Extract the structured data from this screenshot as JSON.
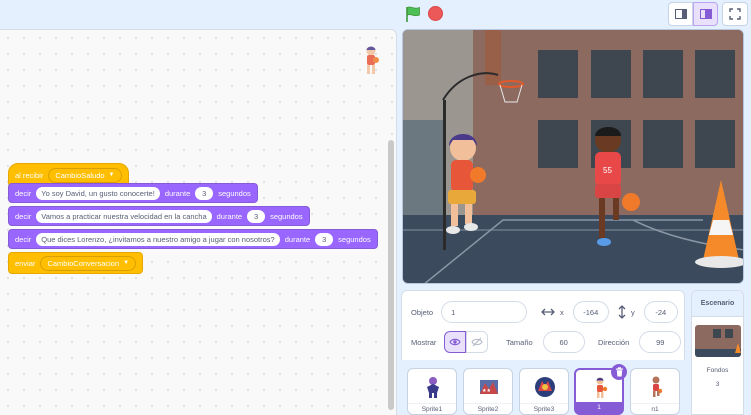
{
  "toolbar": {
    "icons": [
      "green-flag-icon",
      "stop-icon",
      "small-stage-icon",
      "normal-stage-icon",
      "fullscreen-icon"
    ]
  },
  "script": {
    "hat": {
      "label": "al recibir",
      "message": "CambioSaludo"
    },
    "say_blocks": [
      {
        "label": "decir",
        "text": "Yo soy David, un gusto conocerte!",
        "durante": "durante",
        "seconds": "3",
        "unit": "segundos"
      },
      {
        "label": "decir",
        "text": "Vamos a practicar nuestra velocidad en la cancha",
        "durante": "durante",
        "seconds": "3",
        "unit": "segundos"
      },
      {
        "label": "decir",
        "text": "Que dices Lorenzo, ¿invitamos a nuestro amigo a jugar con nosotros?",
        "durante": "durante",
        "seconds": "3",
        "unit": "segundos"
      }
    ],
    "send": {
      "label": "enviar",
      "message": "CambioConversacion"
    }
  },
  "sprite_info": {
    "object_label": "Objeto",
    "object_value": "1",
    "x_label": "x",
    "x_value": "-164",
    "y_label": "y",
    "y_value": "-24",
    "show_label": "Mostrar",
    "size_label": "Tamaño",
    "size_value": "60",
    "direction_label": "Dirección",
    "direction_value": "99"
  },
  "sprites": [
    {
      "name": "Sprite1"
    },
    {
      "name": "Sprite2"
    },
    {
      "name": "Sprite3"
    },
    {
      "name": "1",
      "selected": true
    },
    {
      "name": "n1"
    }
  ],
  "scene": {
    "title": "Escenario",
    "backdrops_label": "Fondos",
    "backdrops_count": "3"
  },
  "colors": {
    "events": "#ffbf00",
    "looks": "#9966ff",
    "accent": "#855cd6"
  }
}
